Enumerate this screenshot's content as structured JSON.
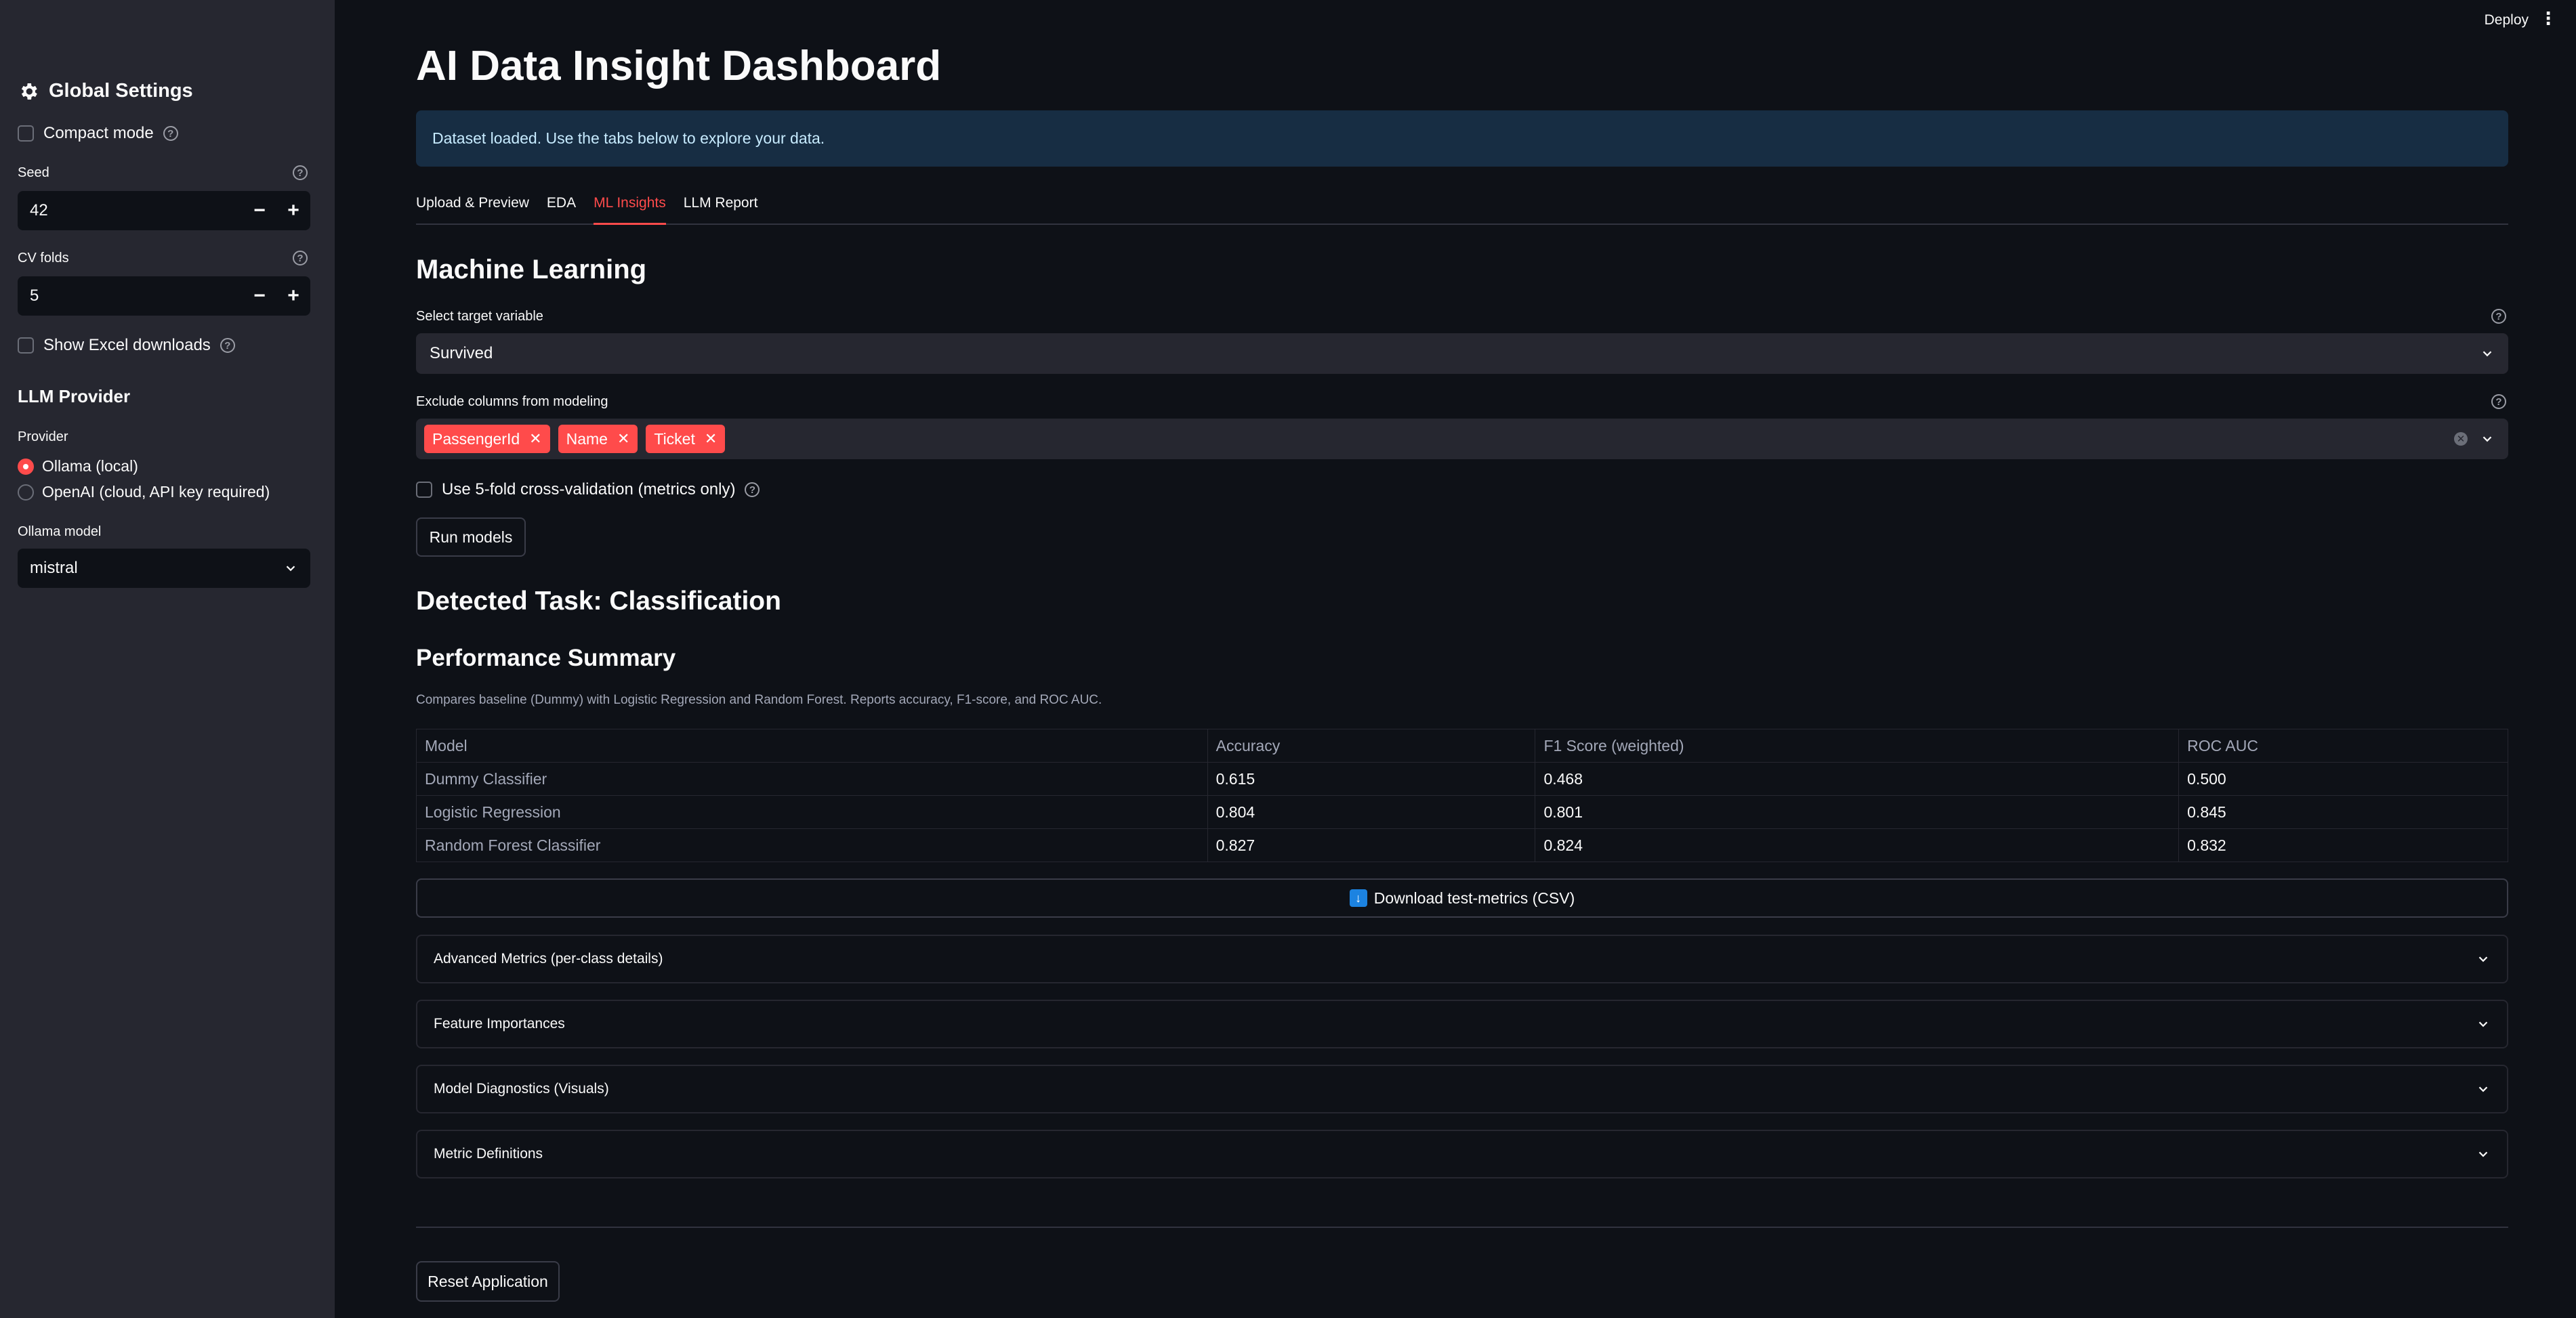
{
  "header": {
    "deploy_label": "Deploy",
    "menu_icon": "kebab-menu-icon"
  },
  "sidebar": {
    "title": "Global Settings",
    "title_icon": "gear-icon",
    "compact_mode_label": "Compact mode",
    "seed": {
      "label": "Seed",
      "value": "42"
    },
    "cv_folds": {
      "label": "CV folds",
      "value": "5"
    },
    "excel_label": "Show Excel downloads",
    "llm_provider_heading": "LLM Provider",
    "provider_label": "Provider",
    "provider_options": [
      "Ollama (local)",
      "OpenAI (cloud, API key required)"
    ],
    "provider_selected": "Ollama (local)",
    "ollama_model_label": "Ollama model",
    "ollama_model_value": "mistral"
  },
  "main": {
    "title": "AI Data Insight Dashboard",
    "info": "Dataset loaded. Use the tabs below to explore your data.",
    "tabs": [
      {
        "label": "Upload & Preview"
      },
      {
        "label": "EDA"
      },
      {
        "label": "ML Insights"
      },
      {
        "label": "LLM Report"
      }
    ],
    "active_tab": "ML Insights",
    "section_title": "Machine Learning",
    "target_label": "Select target variable",
    "target_value": "Survived",
    "exclude_label": "Exclude columns from modeling",
    "exclude_tags": [
      "PassengerId",
      "Name",
      "Ticket"
    ],
    "cv_checkbox_label": "Use 5-fold cross-validation (metrics only)",
    "run_button": "Run models",
    "detected_task": "Detected Task: Classification",
    "performance_title": "Performance Summary",
    "performance_caption": "Compares baseline (Dummy) with Logistic Regression and Random Forest. Reports accuracy, F1-score, and ROC AUC.",
    "table": {
      "headers": [
        "Model",
        "Accuracy",
        "F1 Score (weighted)",
        "ROC AUC"
      ],
      "rows": [
        [
          "Dummy Classifier",
          "0.615",
          "0.468",
          "0.500"
        ],
        [
          "Logistic Regression",
          "0.804",
          "0.801",
          "0.845"
        ],
        [
          "Random Forest Classifier",
          "0.827",
          "0.824",
          "0.832"
        ]
      ]
    },
    "download_button": "Download test-metrics (CSV)",
    "expanders": [
      {
        "label": "Advanced Metrics (per-class details)"
      },
      {
        "label": "Feature Importances"
      },
      {
        "label": "Model Diagnostics (Visuals)"
      },
      {
        "label": "Metric Definitions"
      }
    ],
    "reset_button": "Reset Application"
  },
  "colors": {
    "accent": "#ff4b4b",
    "background": "#0e1117",
    "sidebar": "#262730",
    "info_bg": "#172d43"
  }
}
